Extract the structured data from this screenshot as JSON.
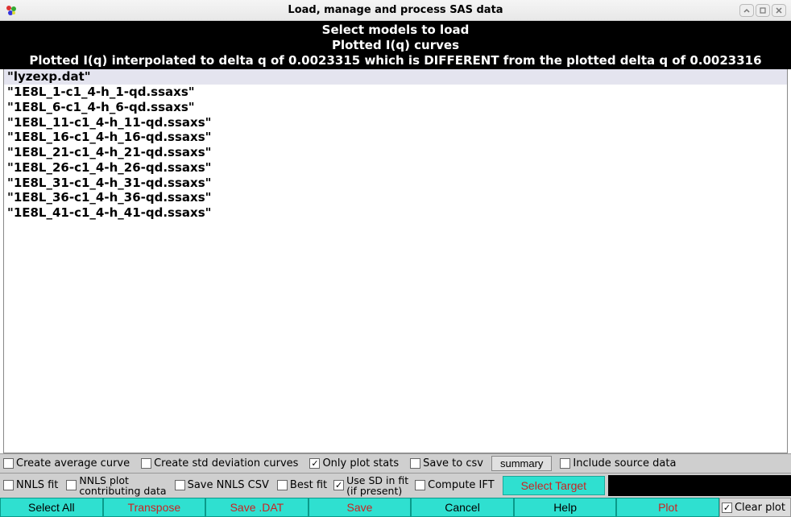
{
  "window": {
    "title": "Load, manage and process SAS data"
  },
  "header": {
    "line1": "Select models to load",
    "line2": "Plotted I(q) curves",
    "line3": "Plotted I(q) interpolated to delta q of 0.0023315 which is DIFFERENT from the plotted delta q of 0.0023316"
  },
  "files": [
    {
      "name": "\"lyzexp.dat\"",
      "selected": true
    },
    {
      "name": "\"1E8L_1-c1_4-h_1-qd.ssaxs\"",
      "selected": false
    },
    {
      "name": "\"1E8L_6-c1_4-h_6-qd.ssaxs\"",
      "selected": false
    },
    {
      "name": "\"1E8L_11-c1_4-h_11-qd.ssaxs\"",
      "selected": false
    },
    {
      "name": "\"1E8L_16-c1_4-h_16-qd.ssaxs\"",
      "selected": false
    },
    {
      "name": "\"1E8L_21-c1_4-h_21-qd.ssaxs\"",
      "selected": false
    },
    {
      "name": "\"1E8L_26-c1_4-h_26-qd.ssaxs\"",
      "selected": false
    },
    {
      "name": "\"1E8L_31-c1_4-h_31-qd.ssaxs\"",
      "selected": false
    },
    {
      "name": "\"1E8L_36-c1_4-h_36-qd.ssaxs\"",
      "selected": false
    },
    {
      "name": "\"1E8L_41-c1_4-h_41-qd.ssaxs\"",
      "selected": false
    }
  ],
  "row1": {
    "create_avg": {
      "label": "Create average curve",
      "checked": false
    },
    "create_std": {
      "label": "Create std deviation curves",
      "checked": false
    },
    "only_plot": {
      "label": "Only plot stats",
      "checked": true
    },
    "save_csv": {
      "label": "Save to csv",
      "checked": false
    },
    "summary_btn": "summary",
    "include_src": {
      "label": "Include source data",
      "checked": false
    }
  },
  "row2": {
    "nnls_fit": {
      "label": "NNLS fit",
      "checked": false
    },
    "nnls_plot": {
      "label": "NNLS plot\ncontributing data",
      "checked": false
    },
    "save_nnls_csv": {
      "label": "Save NNLS CSV",
      "checked": false
    },
    "best_fit": {
      "label": "Best fit",
      "checked": false
    },
    "use_sd": {
      "label": "Use SD in fit\n(if present)",
      "checked": true
    },
    "compute_ift": {
      "label": "Compute IFT",
      "checked": false
    },
    "select_target": "Select Target"
  },
  "buttons": {
    "select_all": "Select All",
    "transpose": "Transpose",
    "save_dat": "Save .DAT",
    "save": "Save",
    "cancel": "Cancel",
    "help": "Help",
    "plot": "Plot",
    "clear_plot": {
      "label": "Clear plot",
      "checked": true
    }
  }
}
